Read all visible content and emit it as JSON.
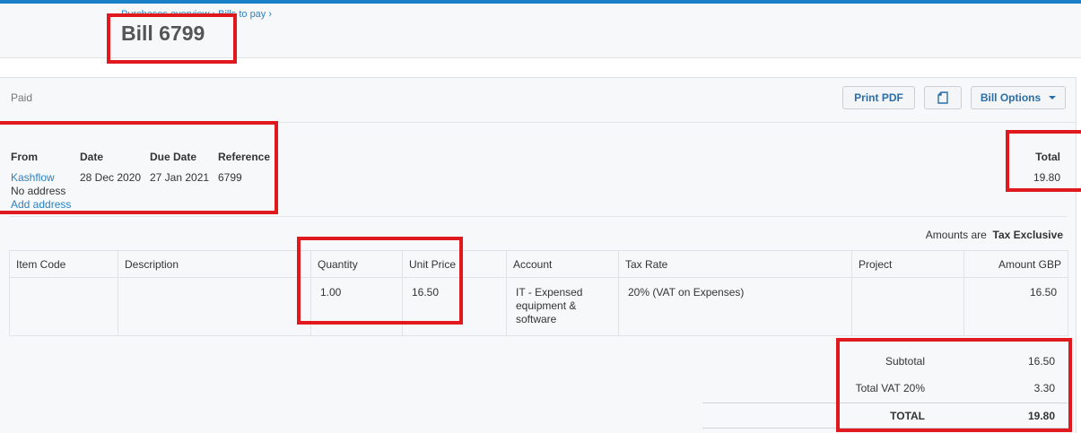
{
  "breadcrumb": {
    "items": [
      "Purchases overview",
      "Bills to pay"
    ]
  },
  "title": "Bill 6799",
  "status": "Paid",
  "toolbar": {
    "print_pdf": "Print PDF",
    "bill_options": "Bill Options"
  },
  "meta": {
    "from_label": "From",
    "date_label": "Date",
    "due_label": "Due Date",
    "ref_label": "Reference",
    "total_label": "Total",
    "from_value": "Kashflow",
    "no_address": "No address",
    "add_address": "Add address",
    "date_value": "28 Dec 2020",
    "due_value": "27 Jan 2021",
    "ref_value": "6799",
    "total_value": "19.80"
  },
  "amounts": {
    "prefix": "Amounts are",
    "mode": "Tax Exclusive"
  },
  "table": {
    "headers": [
      "Item Code",
      "Description",
      "Quantity",
      "Unit Price",
      "Account",
      "Tax Rate",
      "Project",
      "Amount GBP"
    ],
    "rows": [
      {
        "item_code": "",
        "description": "",
        "quantity": "1.00",
        "unit_price": "16.50",
        "account": "IT - Expensed equipment & software",
        "tax_rate": "20% (VAT on Expenses)",
        "project": "",
        "amount": "16.50"
      }
    ]
  },
  "summary": {
    "subtotal_label": "Subtotal",
    "subtotal_value": "16.50",
    "vat_label": "Total VAT  20%",
    "vat_value": "3.30",
    "total_label": "TOTAL",
    "total_value": "19.80"
  },
  "colors": {
    "accent": "#1a80c8",
    "link": "#2a82c3",
    "highlight": "#e0191f"
  }
}
